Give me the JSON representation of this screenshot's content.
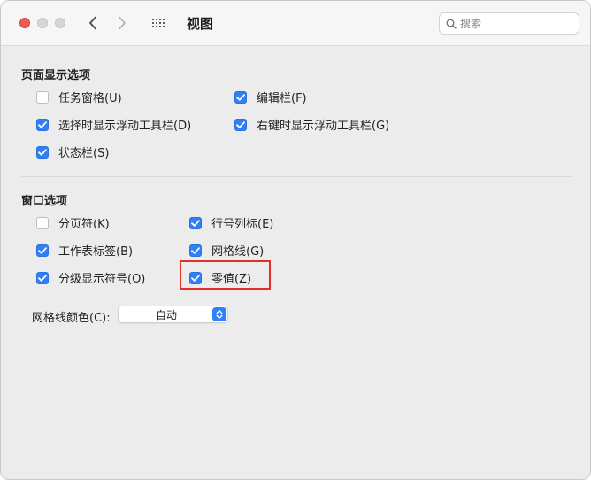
{
  "window": {
    "title": "视图"
  },
  "search": {
    "placeholder": "搜索",
    "value": ""
  },
  "sections": {
    "page_display": {
      "title": "页面显示选项",
      "options": [
        {
          "label": "任务窗格(U)",
          "checked": false
        },
        {
          "label": "编辑栏(F)",
          "checked": true
        },
        {
          "label": "选择时显示浮动工具栏(D)",
          "checked": true
        },
        {
          "label": "右键时显示浮动工具栏(G)",
          "checked": true
        },
        {
          "label": "状态栏(S)",
          "checked": true
        }
      ]
    },
    "window_options": {
      "title": "窗口选项",
      "options": [
        {
          "label": "分页符(K)",
          "checked": false
        },
        {
          "label": "行号列标(E)",
          "checked": true
        },
        {
          "label": "工作表标签(B)",
          "checked": true
        },
        {
          "label": "网格线(G)",
          "checked": true
        },
        {
          "label": "分级显示符号(O)",
          "checked": true
        },
        {
          "label": "零值(Z)",
          "checked": true
        }
      ]
    }
  },
  "gridline_color": {
    "label": "网格线颜色(C):",
    "value": "自动"
  },
  "colors": {
    "accent": "#2f7ff5",
    "highlight_box": "#e0302a",
    "close_button": "#ee5b54"
  },
  "icons": {
    "back": "chevron-left-icon",
    "forward": "chevron-right-icon",
    "grid": "grid-icon",
    "search": "magnifier-icon",
    "check": "checkmark-icon",
    "stepper": "up-down-arrows-icon"
  }
}
